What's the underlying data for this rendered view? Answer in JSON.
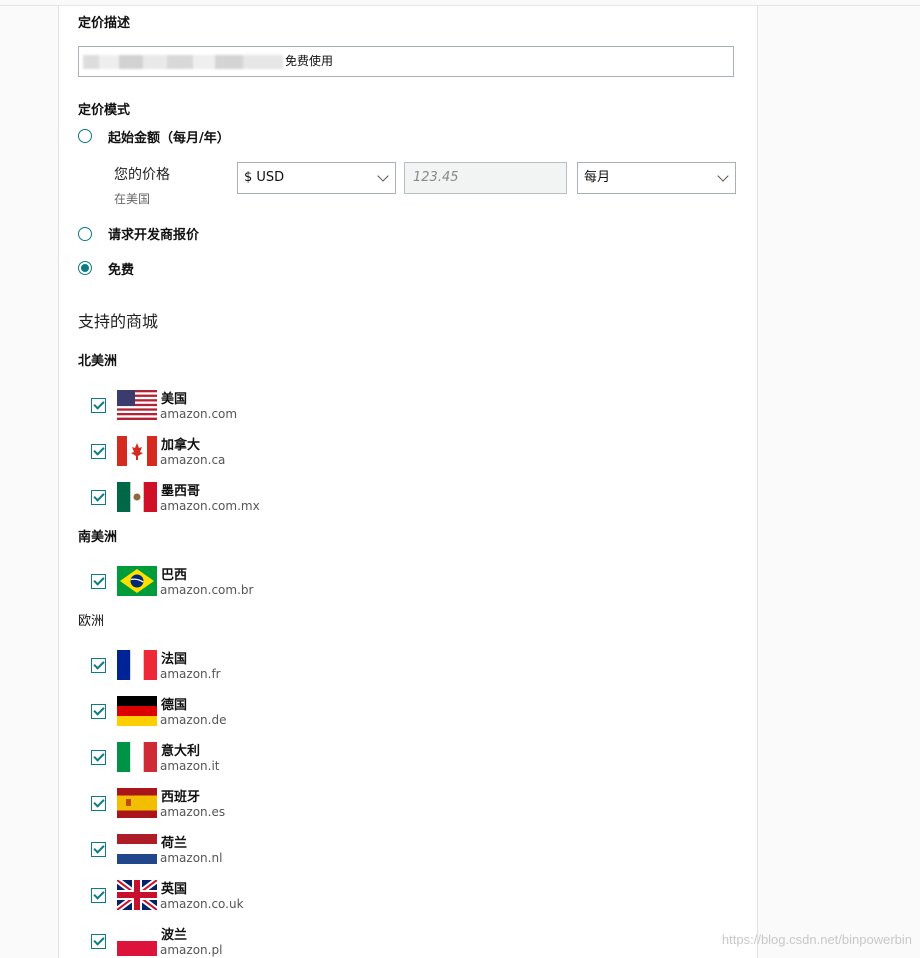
{
  "pricing_description": {
    "label": "定价描述",
    "value": "免费使用"
  },
  "pricing_mode": {
    "label": "定价模式",
    "options": [
      {
        "label": "起始金额（每月/年）",
        "checked": false
      },
      {
        "label": "请求开发商报价",
        "checked": false
      },
      {
        "label": "免费",
        "checked": true
      }
    ],
    "price": {
      "label": "您的价格",
      "sublabel": "在美国",
      "currency": "$ USD",
      "amount_placeholder": "123.45",
      "period": "每月"
    }
  },
  "marketplaces": {
    "title": "支持的商城",
    "regions": [
      {
        "name": "北美洲",
        "countries": [
          {
            "name": "美国",
            "domain": "amazon.com",
            "flag": "us-flag",
            "checked": true
          },
          {
            "name": "加拿大",
            "domain": "amazon.ca",
            "flag": "ca-flag",
            "checked": true
          },
          {
            "name": "墨西哥",
            "domain": "amazon.com.mx",
            "flag": "mx-flag",
            "checked": true
          }
        ]
      },
      {
        "name": "南美洲",
        "countries": [
          {
            "name": "巴西",
            "domain": "amazon.com.br",
            "flag": "br-flag",
            "checked": true
          }
        ]
      },
      {
        "name": "欧洲",
        "countries": [
          {
            "name": "法国",
            "domain": "amazon.fr",
            "flag": "fr-flag",
            "checked": true
          },
          {
            "name": "德国",
            "domain": "amazon.de",
            "flag": "de-flag",
            "checked": true
          },
          {
            "name": "意大利",
            "domain": "amazon.it",
            "flag": "it-flag",
            "checked": true
          },
          {
            "name": "西班牙",
            "domain": "amazon.es",
            "flag": "es-flag",
            "checked": true
          },
          {
            "name": "荷兰",
            "domain": "amazon.nl",
            "flag": "nl-flag",
            "checked": true
          },
          {
            "name": "英国",
            "domain": "amazon.co.uk",
            "flag": "uk-flag",
            "checked": true
          },
          {
            "name": "波兰",
            "domain": "amazon.pl",
            "flag": "pl-flag",
            "checked": true
          }
        ]
      }
    ]
  },
  "watermark": "https://blog.csdn.net/binpowerbin",
  "colors": {
    "accent": "#0d7b86",
    "border": "#a9b1b7"
  }
}
